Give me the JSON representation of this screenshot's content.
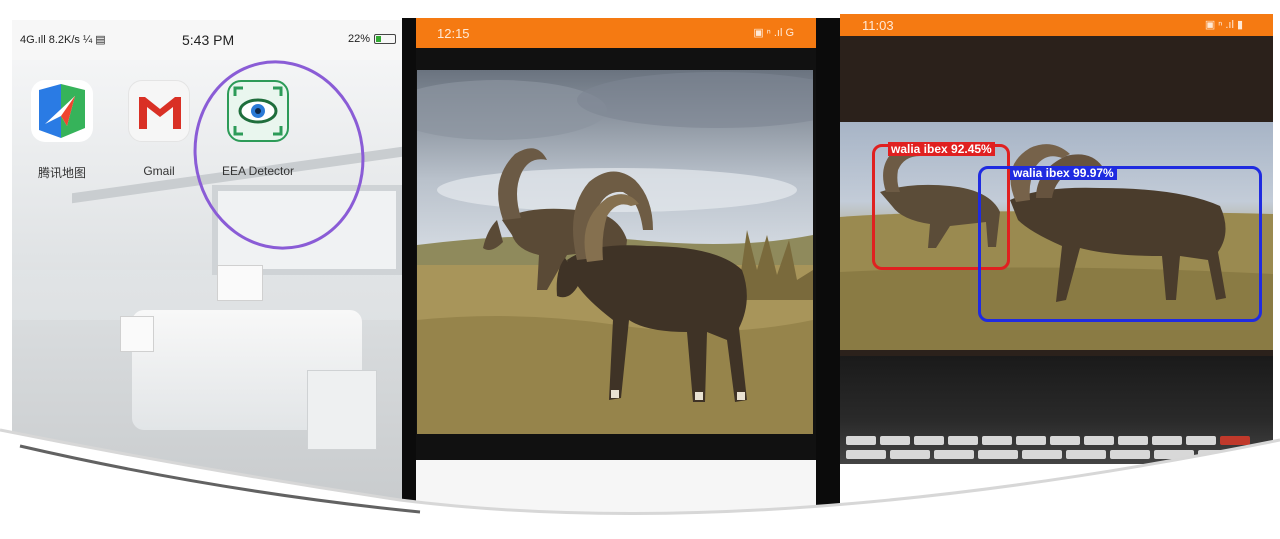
{
  "panel_home": {
    "status_bar": {
      "network": "4G.ıll 8.2K/s ¼ ▤",
      "time": "5:43 PM",
      "battery_text": "22%"
    },
    "apps": [
      {
        "label": "腾讯地图",
        "icon": "map-app-icon"
      },
      {
        "label": "Gmail",
        "icon": "gmail-icon"
      },
      {
        "label": "EEA Detector",
        "icon": "eye-detector-icon"
      }
    ],
    "highlight_color": "#8a5cd6"
  },
  "panel_viewer": {
    "status_bar": {
      "time": "12:15",
      "right": "▣ ⁿ .ıl G"
    },
    "accent": "#f57a12"
  },
  "panel_detector": {
    "status_bar": {
      "time": "11:03",
      "right": "▣ ⁿ .ıl ▮"
    },
    "detections": [
      {
        "label": "walia ibex 92.45%",
        "color": "#e02020"
      },
      {
        "label": "walia ibex 99.97%",
        "color": "#1f2be0"
      }
    ]
  }
}
